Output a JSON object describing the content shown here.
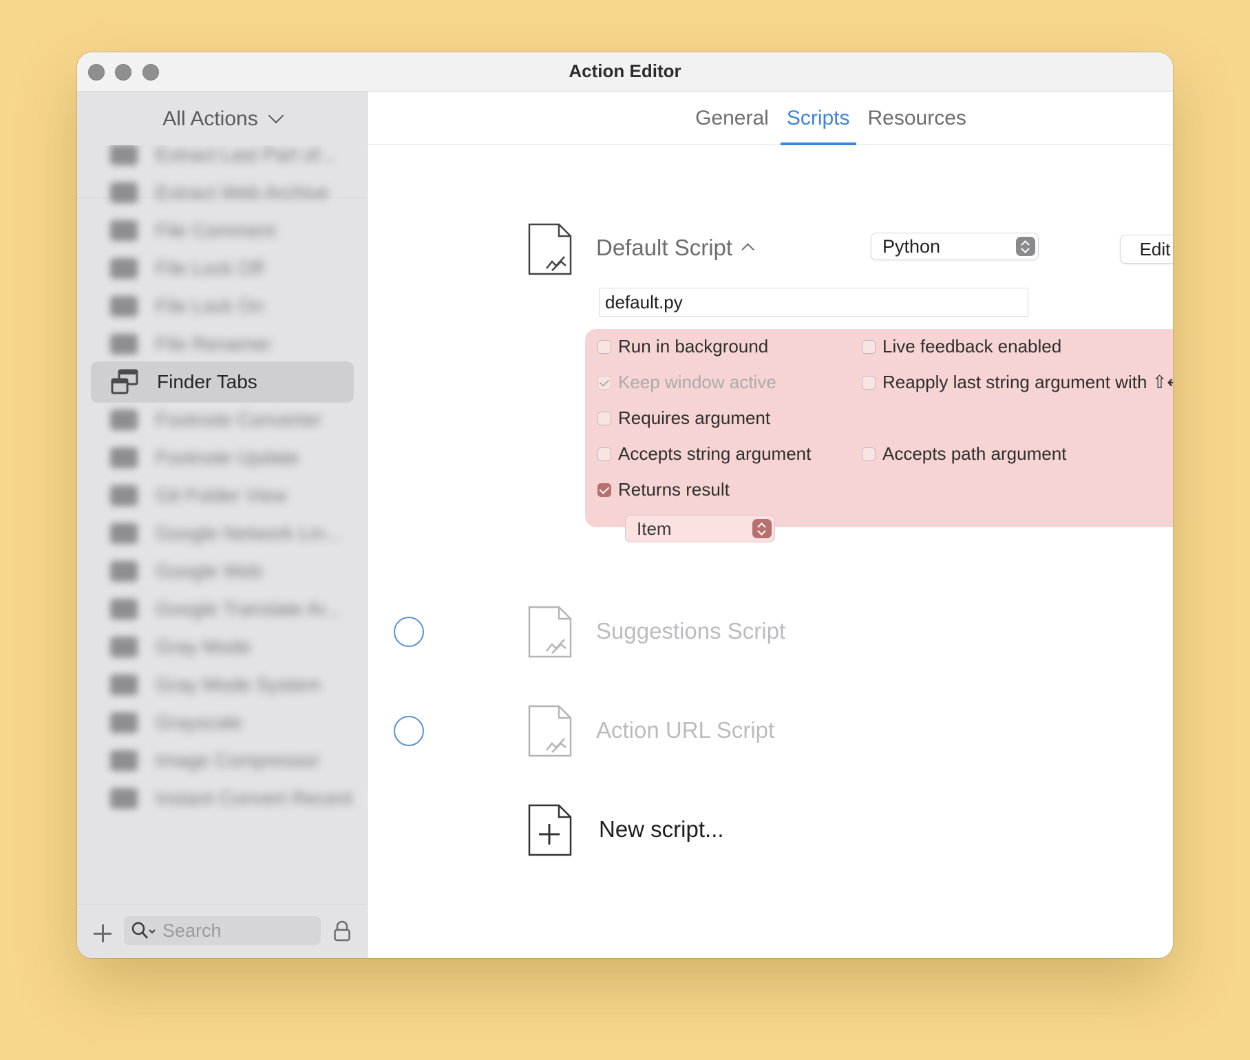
{
  "window": {
    "title": "Action Editor"
  },
  "sidebar": {
    "dropdown_label": "All Actions",
    "items": [
      {
        "label": "Extract Last Part of..."
      },
      {
        "label": "Extract Web Archive"
      },
      {
        "label": "File Comment"
      },
      {
        "label": "File Lock Off"
      },
      {
        "label": "File Lock On"
      },
      {
        "label": "File Renamer"
      },
      {
        "label": "Finder Tabs"
      },
      {
        "label": "Footnote Converter"
      },
      {
        "label": "Footnote Update"
      },
      {
        "label": "Git Folder View"
      },
      {
        "label": "Google Network Lin..."
      },
      {
        "label": "Google Web"
      },
      {
        "label": "Google Translate Ar..."
      },
      {
        "label": "Gray Mode"
      },
      {
        "label": "Gray Mode System"
      },
      {
        "label": "Grayscale"
      },
      {
        "label": "Image Compressor"
      },
      {
        "label": "Instant Convert Recent"
      }
    ],
    "selected_index": 6,
    "search_placeholder": "Search"
  },
  "tabs": [
    {
      "label": "General"
    },
    {
      "label": "Scripts"
    },
    {
      "label": "Resources"
    }
  ],
  "active_tab": "Scripts",
  "default_script": {
    "title": "Default Script",
    "language": "Python",
    "edit_label": "Edit",
    "filename": "default.py",
    "options": {
      "run_in_background": "Run in background",
      "live_feedback": "Live feedback enabled",
      "keep_window_active": "Keep window active",
      "reapply_last": "Reapply last string argument with ⇧↩",
      "requires_argument": "Requires argument",
      "accepts_string": "Accepts string argument",
      "accepts_path": "Accepts path argument",
      "returns_result": "Returns result"
    },
    "result_type": "Item"
  },
  "suggestions_script": {
    "title": "Suggestions Script"
  },
  "action_url_script": {
    "title": "Action URL Script"
  },
  "new_script": {
    "label": "New script..."
  },
  "colors": {
    "accent": "#3f84db",
    "options_panel": "#f7d4d4",
    "checkbox_checked": "#b86f6f",
    "background": "#f7d78d"
  }
}
